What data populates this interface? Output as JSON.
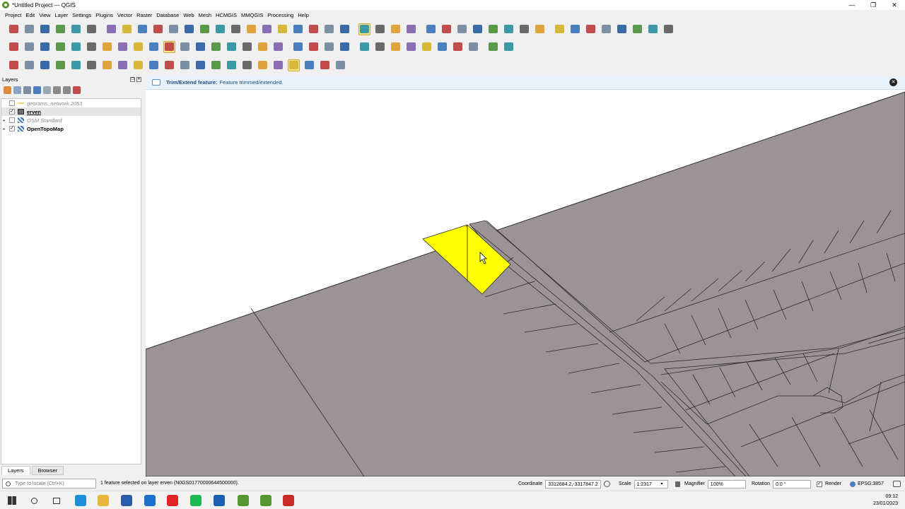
{
  "window": {
    "title": "*Untitled Project — QGIS",
    "controls": [
      "—",
      "❐",
      "✕"
    ]
  },
  "menu": [
    "Project",
    "Edit",
    "View",
    "Layer",
    "Settings",
    "Plugins",
    "Vector",
    "Raster",
    "Database",
    "Web",
    "Mesh",
    "HCMGIS",
    "MMQGIS",
    "Processing",
    "Help"
  ],
  "toolbars": {
    "row1": [
      "new-project",
      "open-project",
      "save-project",
      "save-as",
      "print-layout",
      "style-manager",
      "sep",
      "pan",
      "pan-to-selection",
      "zoom-in",
      "zoom-out",
      "zoom-full",
      "zoom-to-selection",
      "zoom-to-layer",
      "zoom-native",
      "zoom-last",
      "zoom-next",
      "new-map-view",
      "new-3d-view",
      "new-bookmark",
      "show-bookmarks",
      "temporal",
      "refresh",
      "sep",
      "select-features",
      "select-by-value",
      "deselect",
      "select-by-location",
      "sep",
      "identify",
      "attribute-table",
      "settings",
      "statistics",
      "measure-field",
      "measure",
      "map-tips",
      "locator-zoom",
      "sep",
      "snapping",
      "trace",
      "topology",
      "vertex",
      "split",
      "clear",
      "digitize",
      "reshape"
    ],
    "row2": [
      "data-source-manager",
      "new-geopackage",
      "new-virtual",
      "new-shapefile",
      "new-mesh",
      "new-vector",
      "toggle-editing",
      "current-edits",
      "save-edits",
      "add-polygon",
      "vertex-tool",
      "modify-attributes",
      "delete-selected",
      "cut",
      "copy",
      "paste",
      "undo",
      "redo",
      "sep",
      "label",
      "label-pin",
      "label-show",
      "more",
      "sep",
      "georeferencer",
      "coordinate-capture",
      "gps",
      "pan-map",
      "python",
      "binoculars",
      "dem",
      "globe",
      "sep",
      "help",
      "processing"
    ],
    "row3": [
      "advanced-digitize",
      "rotate",
      "offset-curve",
      "reshape-features",
      "split-features",
      "split-parts",
      "merge-features",
      "merge-attributes",
      "rotate-point",
      "simplify",
      "add-ring",
      "add-part",
      "fill-ring",
      "delete-ring",
      "delete-part",
      "reshape",
      "offset",
      "split-feature",
      "trim-extend",
      "merge",
      "align",
      "more2"
    ]
  },
  "layers_panel": {
    "title": "Layers",
    "layers": [
      {
        "name": "georams_network 2053",
        "checked": false,
        "style": "gray",
        "icon": "line",
        "arrow": ""
      },
      {
        "name": "erven",
        "checked": true,
        "style": "bold-underline",
        "icon": "poly",
        "arrow": ""
      },
      {
        "name": "OSM Standard",
        "checked": false,
        "style": "gray",
        "icon": "raster",
        "arrow": "▸"
      },
      {
        "name": "OpenTopoMap",
        "checked": true,
        "style": "bold",
        "icon": "raster",
        "arrow": "▸"
      }
    ],
    "tabs": [
      "Layers",
      "Browser"
    ]
  },
  "message_bar": {
    "title": "Trim/Extend feature:",
    "text": "Feature trimmed/extended."
  },
  "statusbar": {
    "locator_placeholder": "Type to locate (Ctrl+K)",
    "message": "1 feature selected on layer erven (N0GS01770000644500000).",
    "coordinate_label": "Coordinate",
    "coordinate": "3312684.2,-3317847.2",
    "scale_label": "Scale",
    "scale": "1:2317",
    "magnifier_label": "Magnifier",
    "magnifier": "100%",
    "rotation_label": "Rotation",
    "rotation": "0.0 °",
    "render_label": "Render",
    "crs": "EPSG:3857"
  },
  "taskbar": {
    "time": "09:12",
    "date": "23/01/2023",
    "apps": [
      "windows-start",
      "search",
      "task-view",
      "edge",
      "file-explorer",
      "store",
      "mail",
      "youtube",
      "spotify",
      "outlook",
      "qgis-badge",
      "qgis",
      "app"
    ]
  },
  "colors": {
    "parcel": "#9b9396",
    "selected": "#ffff00",
    "message_bg": "#e9f2fb"
  }
}
